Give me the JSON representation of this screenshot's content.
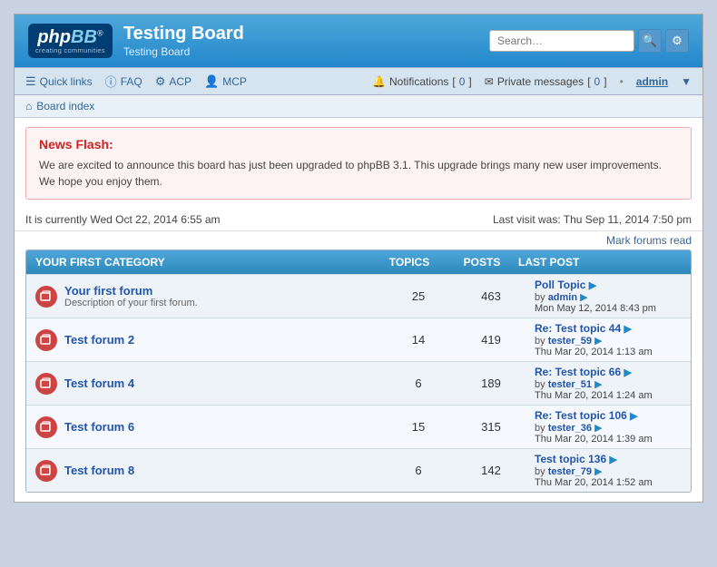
{
  "header": {
    "logo_text": "phpBB",
    "logo_reg": "®",
    "logo_subtitle": "creating communities",
    "board_title": "Testing Board",
    "board_desc": "Testing Board",
    "search_placeholder": "Search…"
  },
  "nav": {
    "quick_links": "Quick links",
    "faq": "FAQ",
    "acp": "ACP",
    "mcp": "MCP",
    "notifications_label": "Notifications",
    "notifications_count": "0",
    "private_messages_label": "Private messages",
    "private_messages_count": "0",
    "admin_user": "admin",
    "dot": "•"
  },
  "breadcrumb": {
    "board_index": "Board index"
  },
  "news_flash": {
    "title": "News Flash:",
    "body": "We are excited to announce this board has just been upgraded to phpBB 3.1. This upgrade brings many new user improvements. We hope you enjoy them."
  },
  "status": {
    "current_time": "It is currently Wed Oct 22, 2014 6:55 am",
    "last_visit": "Last visit was: Thu Sep 11, 2014 7:50 pm",
    "mark_forums_read": "Mark forums read"
  },
  "category": {
    "title": "YOUR FIRST CATEGORY",
    "col_topics": "TOPICS",
    "col_posts": "POSTS",
    "col_lastpost": "LAST POST"
  },
  "forums": [
    {
      "name": "Your first forum",
      "desc": "Description of your first forum.",
      "topics": "25",
      "posts": "463",
      "last_topic": "Poll Topic",
      "last_by": "admin",
      "last_date": "Mon May 12, 2014 8:43 pm"
    },
    {
      "name": "Test forum 2",
      "desc": "",
      "topics": "14",
      "posts": "419",
      "last_topic": "Re: Test topic 44",
      "last_by": "tester_59",
      "last_date": "Thu Mar 20, 2014 1:13 am"
    },
    {
      "name": "Test forum 4",
      "desc": "",
      "topics": "6",
      "posts": "189",
      "last_topic": "Re: Test topic 66",
      "last_by": "tester_51",
      "last_date": "Thu Mar 20, 2014 1:24 am"
    },
    {
      "name": "Test forum 6",
      "desc": "",
      "topics": "15",
      "posts": "315",
      "last_topic": "Re: Test topic 106",
      "last_by": "tester_36",
      "last_date": "Thu Mar 20, 2014 1:39 am"
    },
    {
      "name": "Test forum 8",
      "desc": "",
      "topics": "6",
      "posts": "142",
      "last_topic": "Test topic 136",
      "last_by": "tester_79",
      "last_date": "Thu Mar 20, 2014 1:52 am"
    }
  ]
}
